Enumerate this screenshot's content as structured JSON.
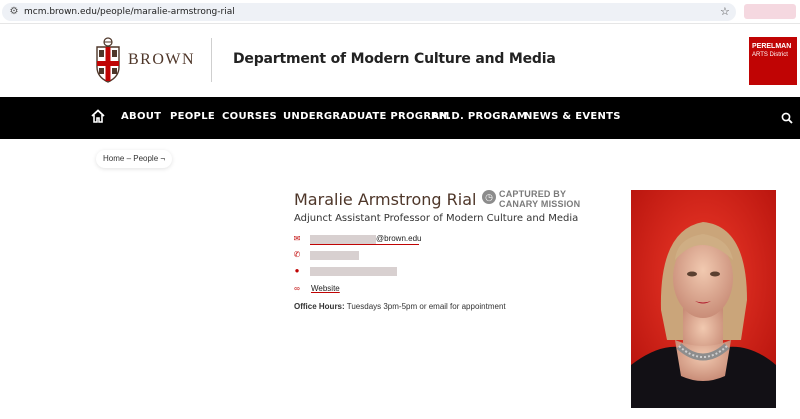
{
  "browser": {
    "url": "mcm.brown.edu/people/maralie-armstrong-rial"
  },
  "header": {
    "logo_text": "BROWN",
    "department": "Department of Modern Culture and Media",
    "pad_line1": "PERELMAN",
    "pad_line2": "ARTS District"
  },
  "nav": {
    "items": [
      "ABOUT",
      "PEOPLE",
      "COURSES",
      "UNDERGRADUATE PROGRAM",
      "PH.D. PROGRAM",
      "NEWS & EVENTS"
    ]
  },
  "breadcrumb": {
    "text": "Home – People ¬"
  },
  "profile": {
    "name": "Maralie Armstrong Rial",
    "title": "Adjunct Assistant Professor of Modern Culture and Media",
    "email_domain": "@brown.edu",
    "website_label": "Website",
    "office_hours_label": "Office Hours:",
    "office_hours_value": " Tuesdays 3pm-5pm or email for appointment"
  },
  "captured": {
    "line1": "CAPTURED BY",
    "line2": "CANARY MISSION"
  },
  "colors": {
    "brand_red": "#c00404",
    "brown": "#4e3629",
    "nav_bg": "#000000"
  },
  "icons": {
    "email": "envelope-icon",
    "phone": "phone-icon",
    "location": "map-pin-icon",
    "website": "link-icon"
  }
}
